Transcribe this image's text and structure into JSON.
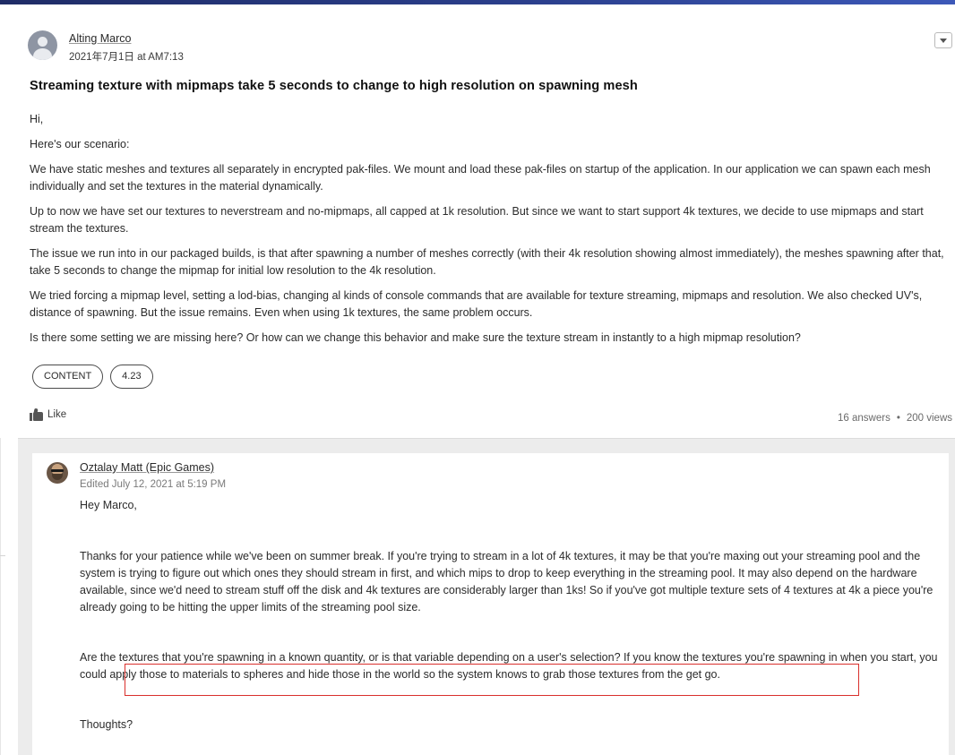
{
  "question": {
    "author": "Alting Marco",
    "date": "2021年7月1日 at AM7:13",
    "title": "Streaming texture with mipmaps take 5 seconds to change to high resolution on spawning mesh",
    "paragraphs": [
      "Hi,",
      "Here's our scenario:",
      "We have static meshes and textures all separately in encrypted pak-files. We mount and load these pak-files on startup of the application. In our application we can spawn each mesh individually and set the textures in the material dynamically.",
      "Up to now we have set our textures to neverstream and no-mipmaps, all capped at 1k resolution. But since we want to start support 4k textures, we decide to use mipmaps and start stream the textures.",
      "The issue we run into in our packaged builds, is that after spawning a number of meshes correctly (with their 4k resolution showing almost immediately), the meshes spawning after that, take 5 seconds to change the mipmap for initial low resolution to the 4k resolution.",
      "We tried forcing a mipmap level, setting a lod-bias, changing al kinds of console commands that are available for texture streaming, mipmaps and resolution. We also checked UV's, distance of spawning. But the issue remains. Even when using 1k textures, the same problem occurs.",
      "Is there some setting we are missing here? Or how can we change this behavior and make sure the texture stream in instantly to a high mipmap resolution?"
    ],
    "tags": [
      "CONTENT",
      "4.23"
    ],
    "like_label": "Like",
    "answers_count": "16 answers",
    "views_count": "200 views",
    "separator": "•"
  },
  "answer": {
    "author": "Oztalay Matt (Epic Games)",
    "edited": "Edited July 12, 2021 at 5:19 PM",
    "paragraphs": [
      "Hey Marco,",
      "Thanks for your patience while we've been on summer break. If you're trying to stream in a lot of 4k textures, it may be that you're maxing out your streaming pool and the system is trying to figure out which ones they should stream in first, and which mips to drop to keep everything in the streaming pool. It may also depend on the hardware available, since we'd need to stream stuff off the disk and 4k textures are considerably larger than 1ks! So if you've got multiple texture sets of 4 textures at 4k a piece you're already going to be hitting the upper limits of the streaming pool size.",
      "Are the textures that you're spawning in a known quantity, or is that variable depending on a user's selection? If you know the textures you're spawning in when you start, you could apply those to materials to spheres and hide those in the world so the system knows to grab those textures from the get go.",
      "Thoughts?"
    ]
  },
  "icons": {
    "avatar": "default-user-avatar-icon",
    "dropdown": "chevron-down-icon",
    "like": "thumbs-up-icon"
  },
  "colors": {
    "top_bar": "#2b3f8c",
    "highlight_box": "#d9302c",
    "answers_background": "#ececec"
  }
}
